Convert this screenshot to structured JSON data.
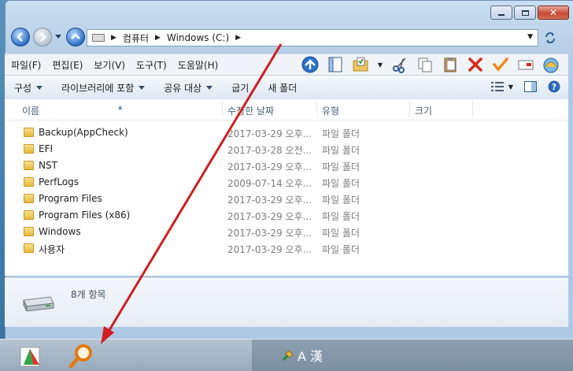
{
  "window": {
    "caption_buttons": [
      "minimize",
      "maximize",
      "close"
    ]
  },
  "nav": {
    "address": {
      "crumbs": [
        "컴퓨터",
        "Windows (C:)"
      ]
    }
  },
  "menubar": {
    "items": [
      "파일(F)",
      "편집(E)",
      "보기(V)",
      "도구(T)",
      "도움말(H)"
    ]
  },
  "commandbar": {
    "items": [
      "구성",
      "라이브러리에 포함",
      "공유 대상",
      "굽기",
      "새 폴더"
    ]
  },
  "columns": {
    "name": "이름",
    "date": "수정한 날짜",
    "type": "유형",
    "size": "크기"
  },
  "files": [
    {
      "name": "Backup(AppCheck)",
      "date": "2017-03-29 오후...",
      "type": "파일 폴더"
    },
    {
      "name": "EFI",
      "date": "2017-03-28 오전...",
      "type": "파일 폴더"
    },
    {
      "name": "NST",
      "date": "2017-03-29 오후...",
      "type": "파일 폴더"
    },
    {
      "name": "PerfLogs",
      "date": "2009-07-14 오후...",
      "type": "파일 폴더"
    },
    {
      "name": "Program Files",
      "date": "2017-03-29 오후...",
      "type": "파일 폴더"
    },
    {
      "name": "Program Files (x86)",
      "date": "2017-03-29 오후...",
      "type": "파일 폴더"
    },
    {
      "name": "Windows",
      "date": "2017-03-29 오후...",
      "type": "파일 폴더"
    },
    {
      "name": "사용자",
      "date": "2017-03-29 오후...",
      "type": "파일 폴더"
    }
  ],
  "details": {
    "item_count": "8개 항목"
  },
  "taskbar": {
    "ime_text": "A 漢"
  },
  "colors": {
    "annotation_arrow": "#d01f1f",
    "accent": "#2e6fc4"
  }
}
